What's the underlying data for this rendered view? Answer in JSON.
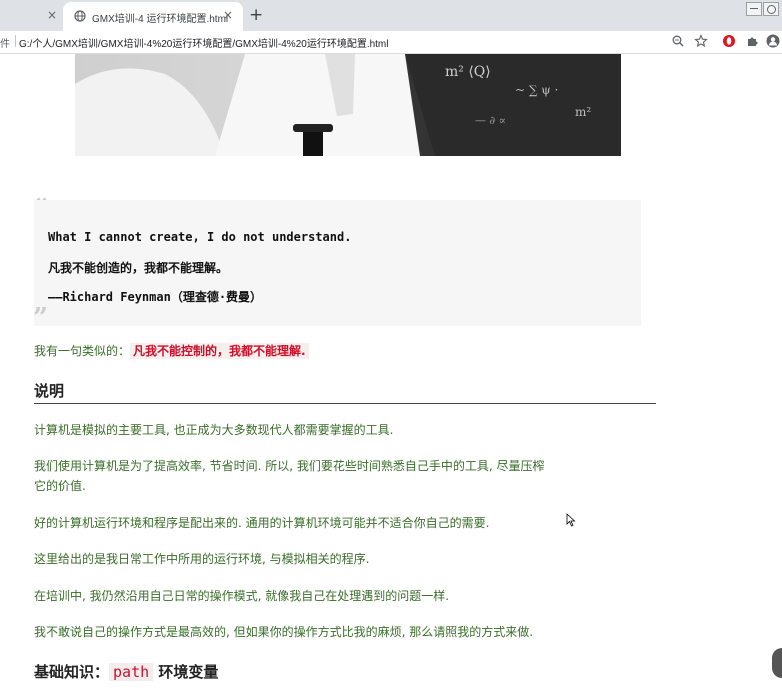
{
  "browser": {
    "prev_tab_close": "×",
    "tab_title": "GMX培训-4 运行环境配置.html",
    "tab_close": "×",
    "new_tab": "+",
    "address_scheme": "件",
    "address_url": "G:/个人/GMX培训/GMX培训-4%20运行环境配置/GMX培训-4%20运行环境配置.html"
  },
  "quote": {
    "open_mark": "“",
    "close_mark": "”",
    "line1": "What I cannot create, I do not understand.",
    "line2": "凡我不能创造的，我都不能理解。",
    "line3": "——Richard Feynman（理查德·费曼）"
  },
  "intro": {
    "prefix": "我有一句类似的：",
    "highlight": "凡我不能控制的，我都不能理解."
  },
  "section1": {
    "title": "说明",
    "paragraphs": [
      "计算机是模拟的主要工具, 也正成为大多数现代人都需要掌握的工具.",
      "我们使用计算机是为了提高效率, 节省时间. 所以, 我们要花些时间熟悉自己手中的工具, 尽量压榨",
      "它的价值.",
      "好的计算机运行环境和程序是配出来的. 通用的计算机环境可能并不适合你自己的需要.",
      "这里给出的是我日常工作中所用的运行环境, 与模拟相关的程序.",
      "在培训中, 我仍然沿用自己日常的操作模式, 就像我自己在处理遇到的问题一样.",
      "我不敢说自己的操作方式是最高效的, 但如果你的操作方式比我的麻烦, 那么请照我的方式来做."
    ]
  },
  "section2": {
    "title_prefix": "基础知识：",
    "title_code": "path",
    "title_suffix": " 环境变量"
  },
  "colors": {
    "body_text": "#3a6e2a",
    "highlight_text": "#d01028",
    "quote_bg": "#f6f6f6"
  }
}
